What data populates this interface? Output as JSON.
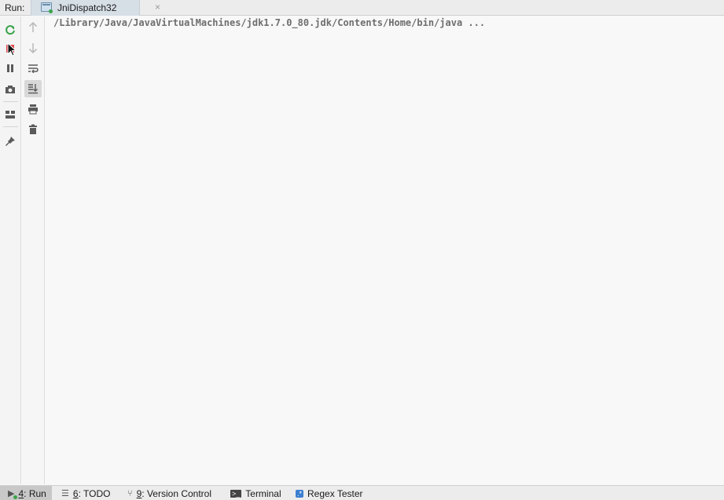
{
  "header": {
    "run_label": "Run:",
    "tab": {
      "title": "JniDispatch32",
      "close": "×"
    }
  },
  "toolbar_left": [
    {
      "icon": "rerun-icon"
    },
    {
      "icon": "stop-icon"
    },
    {
      "icon": "pause-icon"
    },
    {
      "icon": "camera-icon"
    },
    {
      "icon": "layout-icon"
    },
    {
      "icon": "pin-icon"
    }
  ],
  "toolbar_right": [
    {
      "icon": "arrow-up-icon",
      "disabled": true
    },
    {
      "icon": "arrow-down-icon",
      "disabled": true
    },
    {
      "icon": "soft-wrap-icon"
    },
    {
      "icon": "scroll-to-end-icon",
      "active": true
    },
    {
      "icon": "print-icon"
    },
    {
      "icon": "trash-icon"
    }
  ],
  "console": {
    "line": "/Library/Java/JavaVirtualMachines/jdk1.7.0_80.jdk/Contents/Home/bin/java ..."
  },
  "statusbar": {
    "run": {
      "num": "4",
      "label": ": Run"
    },
    "todo": {
      "num": "6",
      "label": ": TODO"
    },
    "vcs": {
      "num": "9",
      "label": ": Version Control"
    },
    "terminal": {
      "label": "Terminal"
    },
    "regex": {
      "label": "Regex Tester"
    }
  },
  "colors": {
    "stop_red": "#e0474c",
    "rerun_green": "#3aa34a",
    "tab_bg": "#d6dee6"
  }
}
